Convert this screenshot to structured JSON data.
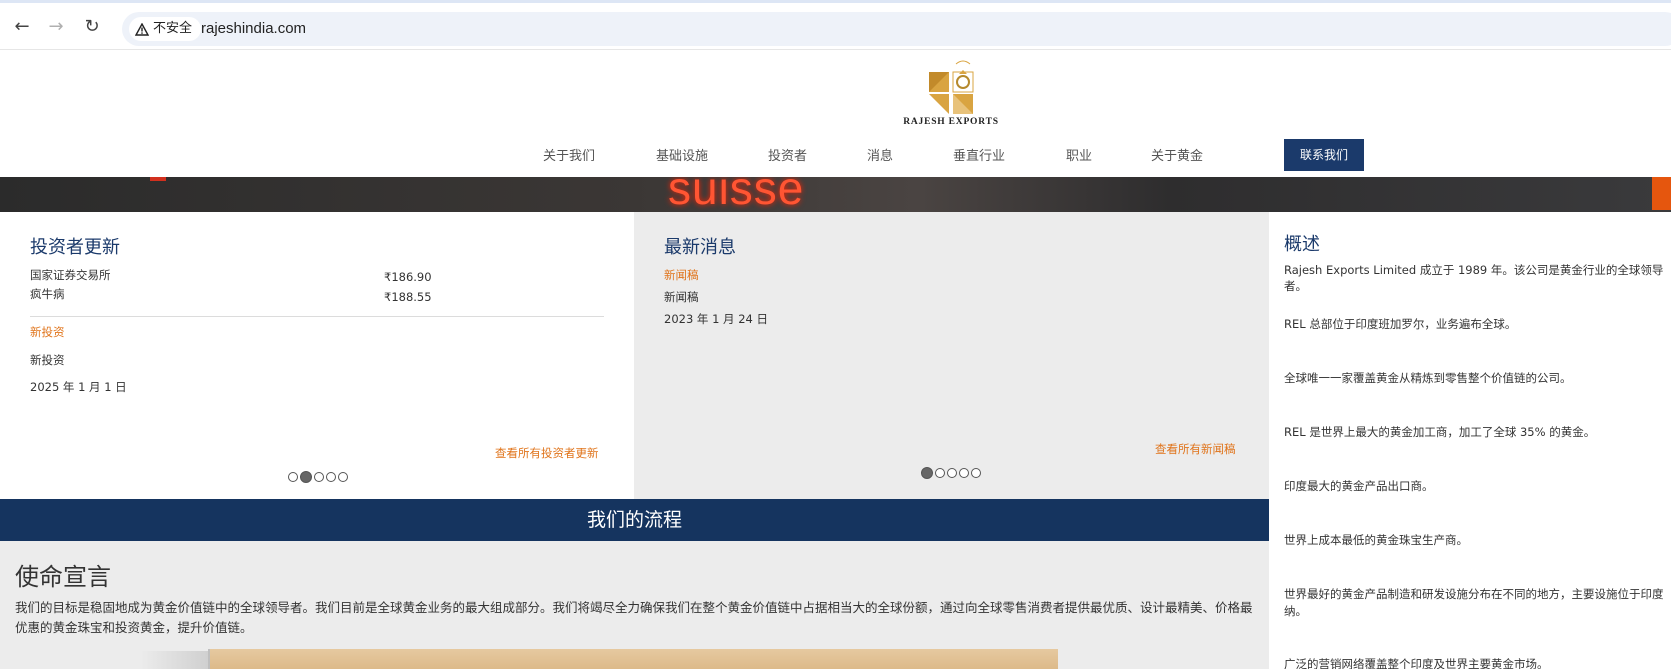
{
  "browser": {
    "security_label": "不安全",
    "url": "rajeshindia.com"
  },
  "header": {
    "logo_text": "RAJESH EXPORTS",
    "nav": [
      "关于我们",
      "基础设施",
      "投资者",
      "消息",
      "垂直行业",
      "职业",
      "关于黄金"
    ],
    "contact_label": "联系我们"
  },
  "hero": {
    "sign_text": "suisse"
  },
  "investor": {
    "title": "投资者更新",
    "rows": [
      {
        "label": "国家证券交易所",
        "price": "₹186.90"
      },
      {
        "label": "疯牛病",
        "price": "₹188.55"
      }
    ],
    "link_title": "新投资",
    "item": "新投资",
    "date": "2025 年 1 月 1 日",
    "view_all": "查看所有投资者更新",
    "carousel_active": 2,
    "carousel_total": 5
  },
  "news": {
    "title": "最新消息",
    "link_title": "新闻稿",
    "item": "新闻稿",
    "date": "2023 年 1 月 24 日",
    "view_all": "查看所有新闻稿",
    "carousel_active": 1,
    "carousel_total": 5
  },
  "process": {
    "title": "我们的流程"
  },
  "mission": {
    "title": "使命宣言",
    "text": "我们的目标是稳固地成为黄金价值链中的全球领导者。我们目前是全球黄金业务的最大组成部分。我们将竭尽全力确保我们在整个黄金价值链中占据相当大的全球份额，通过向全球零售消费者提供最优质、设计最精美、价格最优惠的黄金珠宝和投资黄金，提升价值链。"
  },
  "overview": {
    "title": "概述",
    "items": [
      "Rajesh Exports Limited 成立于 1989 年。该公司是黄金行业的全球领导者。",
      "REL 总部位于印度班加罗尔，业务遍布全球。",
      "全球唯一一家覆盖黄金从精炼到零售整个价值链的公司。",
      "REL 是世界上最大的黄金加工商，加工了全球 35% 的黄金。",
      "印度最大的黄金产品出口商。",
      "世界上成本最低的黄金珠宝生产商。",
      "世界最好的黄金产品制造和研发设施分布在不同的地方，主要设施位于印度",
      "纳。",
      "广泛的营销网络覆盖整个印度及世界主要黄金市场。"
    ]
  },
  "colors": {
    "navy": "#1b3a6b",
    "orange": "#e0741b"
  }
}
